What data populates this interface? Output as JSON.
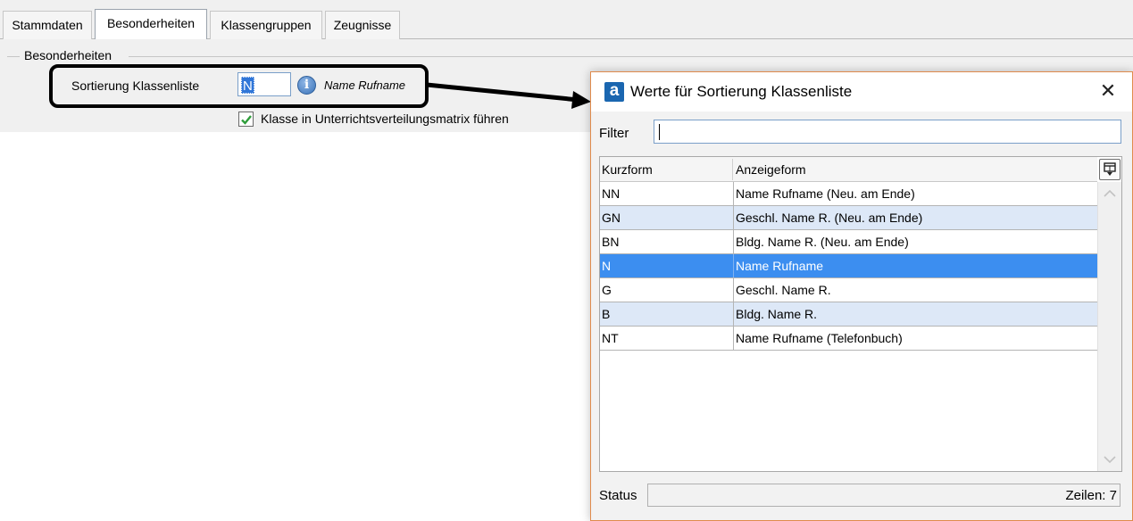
{
  "tabs": [
    {
      "label": "Stammdaten",
      "active": false
    },
    {
      "label": "Besonderheiten",
      "active": true
    },
    {
      "label": "Klassengruppen",
      "active": false
    },
    {
      "label": "Zeugnisse",
      "active": false
    }
  ],
  "form": {
    "group_title": "Besonderheiten",
    "sort_label": "Sortierung Klassenliste",
    "sort_value": "N",
    "sort_description": "Name Rufname",
    "info_glyph": "i",
    "checkbox_label": "Klasse in Unterrichtsverteilungsmatrix führen",
    "checkbox_checked": true
  },
  "dialog": {
    "title": "Werte für Sortierung Klassenliste",
    "app_icon_letter": "a",
    "close_glyph": "✕",
    "filter_label": "Filter",
    "filter_value": "",
    "columns": [
      "Kurzform",
      "Anzeigeform"
    ],
    "rows": [
      {
        "kurz": "NN",
        "anzeige": "Name Rufname (Neu. am Ende)",
        "style": "normal"
      },
      {
        "kurz": "GN",
        "anzeige": "Geschl. Name R. (Neu. am Ende)",
        "style": "alt"
      },
      {
        "kurz": "BN",
        "anzeige": "Bldg. Name R. (Neu. am Ende)",
        "style": "normal"
      },
      {
        "kurz": "N",
        "anzeige": "Name Rufname",
        "style": "sel"
      },
      {
        "kurz": "G",
        "anzeige": "Geschl. Name R.",
        "style": "normal"
      },
      {
        "kurz": "B",
        "anzeige": "Bldg. Name R.",
        "style": "alt"
      },
      {
        "kurz": "NT",
        "anzeige": "Name Rufname (Telefonbuch)",
        "style": "normal"
      }
    ],
    "status_label": "Status",
    "rows_count": "Zeilen: 7"
  },
  "colors": {
    "selection": "#3c8ef0",
    "alt_row": "#dde8f7",
    "dialog_border": "#e08b4c",
    "app_icon": "#1a66b0"
  },
  "icons": [
    "info-icon",
    "checkmark-icon",
    "app-logo-icon",
    "close-icon",
    "column-chooser-icon",
    "scroll-up-icon",
    "scroll-down-icon",
    "arrow-annotation"
  ]
}
